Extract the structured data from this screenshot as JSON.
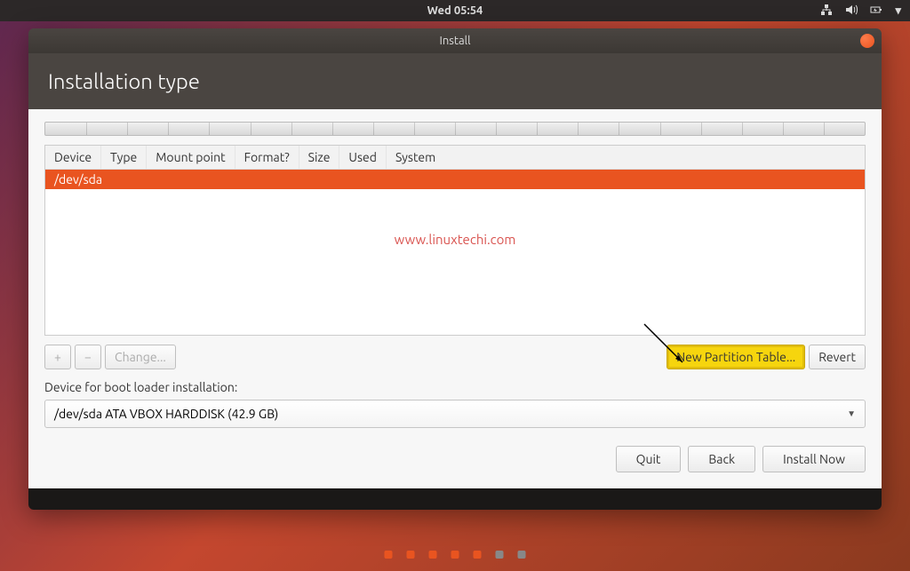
{
  "topbar": {
    "clock": "Wed 05:54"
  },
  "window": {
    "title": "Install",
    "header": "Installation type"
  },
  "table": {
    "columns": [
      "Device",
      "Type",
      "Mount point",
      "Format?",
      "Size",
      "Used",
      "System"
    ],
    "rows": [
      {
        "device": "/dev/sda",
        "type": "",
        "mount": "",
        "format": "",
        "size": "",
        "used": "",
        "system": ""
      }
    ]
  },
  "watermark": "www.linuxtechi.com",
  "buttons": {
    "add": "+",
    "remove": "−",
    "change": "Change...",
    "new_table": "New Partition Table...",
    "revert": "Revert"
  },
  "bootloader": {
    "label": "Device for boot loader installation:",
    "value": "/dev/sda  ATA VBOX HARDDISK (42.9 GB)"
  },
  "footer": {
    "quit": "Quit",
    "back": "Back",
    "install": "Install Now"
  }
}
